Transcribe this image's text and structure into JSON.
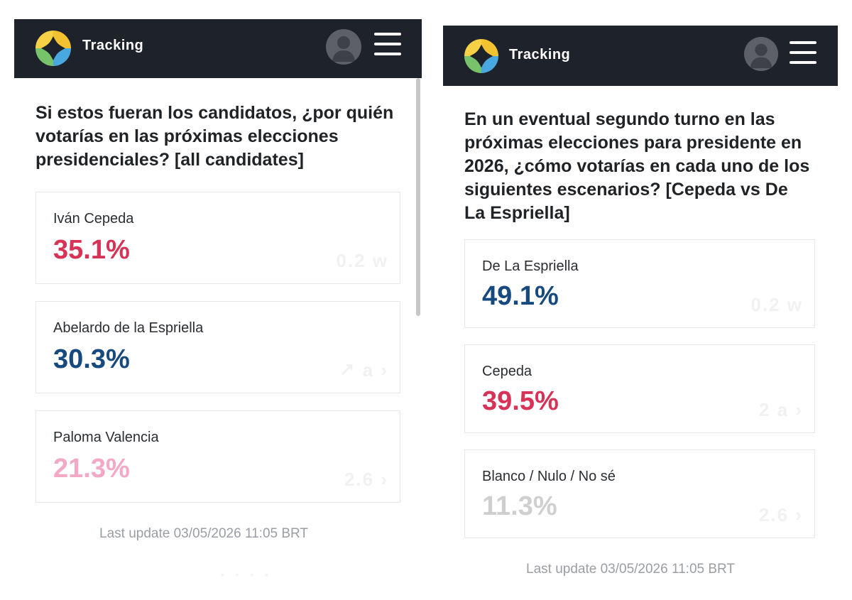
{
  "colors": {
    "topbar": "#1e222a",
    "pink_red": "#d63357",
    "navy": "#164a7e",
    "light_pink": "#f3a8c6",
    "light_gray": "#cfcfcf"
  },
  "left": {
    "brand": "Tracking",
    "avatar_icon": "user-avatar-icon",
    "menu_icon": "hamburger-menu-icon",
    "question": "Si estos fueran los candidatos, ¿por quién votarías en las próximas elecciones presidenciales? [all candidates]",
    "results": [
      {
        "name": "Iván Cepeda",
        "value": "35.1%",
        "color": "#d63357"
      },
      {
        "name": "Abelardo de la Espriella",
        "value": "30.3%",
        "color": "#164a7e"
      },
      {
        "name": "Paloma Valencia",
        "value": "21.3%",
        "color": "#f3a8c6"
      }
    ],
    "last_update": "Last update 03/05/2026 11:05 BRT"
  },
  "right": {
    "brand": "Tracking",
    "avatar_icon": "user-avatar-icon",
    "menu_icon": "hamburger-menu-icon",
    "question": "En un eventual segundo turno en las próximas elecciones para presidente en 2026, ¿cómo votarías en cada uno de los siguientes escenarios? [Cepeda vs De La Espriella]",
    "results": [
      {
        "name": "De La Espriella",
        "value": "49.1%",
        "color": "#164a7e"
      },
      {
        "name": "Cepeda",
        "value": "39.5%",
        "color": "#d63357"
      },
      {
        "name": "Blanco / Nulo / No sé",
        "value": "11.3%",
        "color": "#cfcfcf"
      }
    ],
    "last_update": "Last update 03/05/2026 11:05 BRT"
  }
}
